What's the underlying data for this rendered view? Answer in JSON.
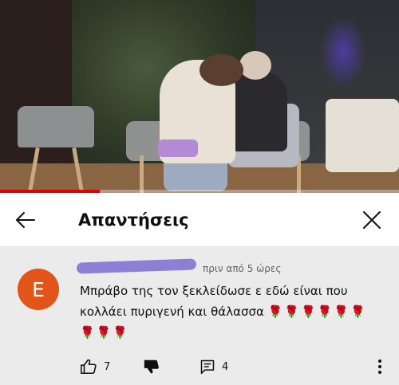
{
  "video": {
    "progress_fraction": 0.25
  },
  "header": {
    "title": "Απαντήσεις",
    "back_icon": "arrow-left-icon",
    "close_icon": "close-icon"
  },
  "comment": {
    "avatar_letter": "E",
    "avatar_color": "#e25418",
    "timestamp": "πριν από 5 ώρες",
    "text": "Μπράβο της τον ξεκλείδωσε ε εδώ είναι που κολλάει πυριγενή και θάλασσα",
    "emoji_line1": "🌹🌹🌹🌹🌹🌹",
    "emoji_line2": "🌹🌹🌹",
    "likes": "7",
    "replies": "4"
  },
  "colors": {
    "progress": "#e00000",
    "comment_bg": "#ebebeb"
  }
}
